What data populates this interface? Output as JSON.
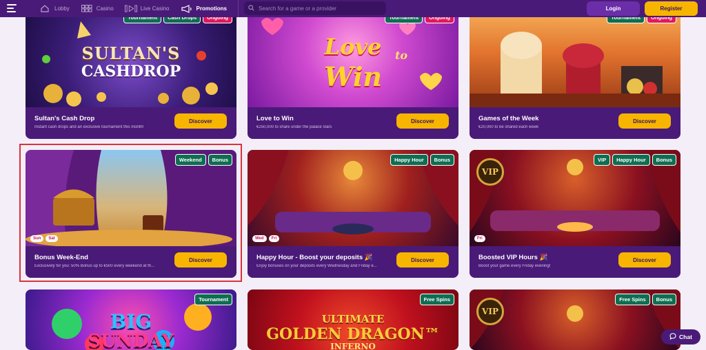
{
  "nav": {
    "items": [
      {
        "label": "Lobby",
        "icon": "home-icon",
        "active": false
      },
      {
        "label": "Casino",
        "icon": "grid-icon",
        "active": false
      },
      {
        "label": "Live Casino",
        "icon": "play-icon",
        "active": false
      },
      {
        "label": "Promotions",
        "icon": "megaphone-icon",
        "active": true
      }
    ]
  },
  "search": {
    "placeholder": "Search for a game or a provider"
  },
  "auth": {
    "login": "Login",
    "register": "Register"
  },
  "cards": [
    {
      "title": "Sultan's Cash Drop",
      "desc": "Instant cash drops and an exclusive tournament this month!",
      "tags": [
        "Tournament",
        "Cash Drops",
        "Ongoing"
      ],
      "cta": "Discover",
      "art_text": [
        "SULTAN'S",
        "CASHDROP"
      ]
    },
    {
      "title": "Love to Win",
      "desc": "€250,000 to share under the palace stars",
      "tags": [
        "Tournament",
        "Ongoing"
      ],
      "cta": "Discover",
      "art_text": [
        "Love",
        "to",
        "Win"
      ]
    },
    {
      "title": "Games of the Week",
      "desc": "€20,000 to be shared each week",
      "tags": [
        "Tournament",
        "Ongoing"
      ],
      "cta": "Discover"
    },
    {
      "title": "Bonus Week-End",
      "desc": "Exclusively for you: 50% Bonus up to €500 every weekend at th...",
      "tags": [
        "Weekend",
        "Bonus"
      ],
      "days": [
        "Sun",
        "Sat"
      ],
      "cta": "Discover"
    },
    {
      "title": "Happy Hour - Boost your deposits 🎉",
      "desc": "Enjoy bonuses on your deposits every Wednesday and Friday e...",
      "tags": [
        "Happy Hour",
        "Bonus"
      ],
      "days": [
        "Wed",
        "Fri"
      ],
      "cta": "Discover"
    },
    {
      "title": "Boosted VIP Hours 🎉",
      "desc": "Boost your game every Friday evening!",
      "tags": [
        "VIP",
        "Happy Hour",
        "Bonus"
      ],
      "days": [
        "Fri"
      ],
      "cta": "Discover",
      "badge": "VIP"
    },
    {
      "tags": [
        "Tournament"
      ],
      "art_text": [
        "BIG",
        "SUNDAY"
      ]
    },
    {
      "tags": [
        "Free Spins"
      ],
      "art_text": [
        "ULTIMATE",
        "GOLDEN DRAGON™",
        "INFERNO"
      ]
    },
    {
      "tags": [
        "Free Spins",
        "Bonus"
      ],
      "badge": "VIP"
    }
  ],
  "chat": {
    "label": "Chat"
  },
  "colors": {
    "header": "#4a1a78",
    "accent": "#f7b500",
    "tag_green": "#0f6e52",
    "tag_pink": "#e2175e"
  }
}
